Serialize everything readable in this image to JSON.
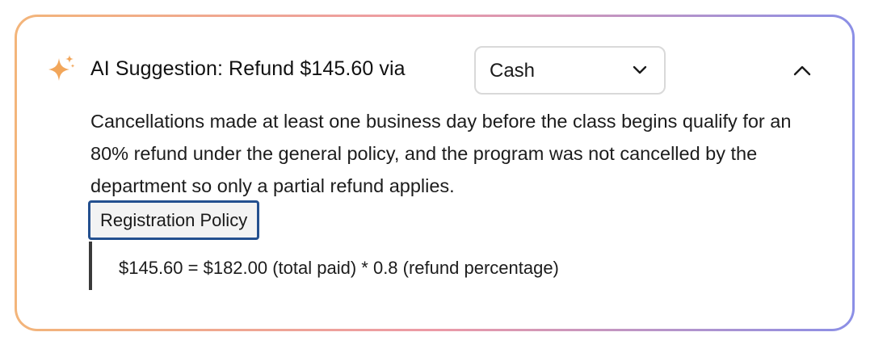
{
  "suggestion": {
    "title": "AI Suggestion: Refund $145.60 via",
    "icon": "sparkle-icon",
    "accent_gradient": [
      "#f3b57a",
      "#ec9aa6",
      "#8b8fe6"
    ]
  },
  "refund_method": {
    "selected": "Cash",
    "icon": "chevron-down-icon"
  },
  "collapse": {
    "icon": "chevron-up-icon"
  },
  "explanation": "Cancellations made at least one business day before the class begins qualify for an 80% refund under the general policy, and the program was not cancelled by the department so only a partial refund applies.",
  "policy_tag": {
    "label": "Registration Policy",
    "border_color": "#24508f"
  },
  "calculation": "$145.60 = $182.00 (total paid) * 0.8 (refund percentage)"
}
